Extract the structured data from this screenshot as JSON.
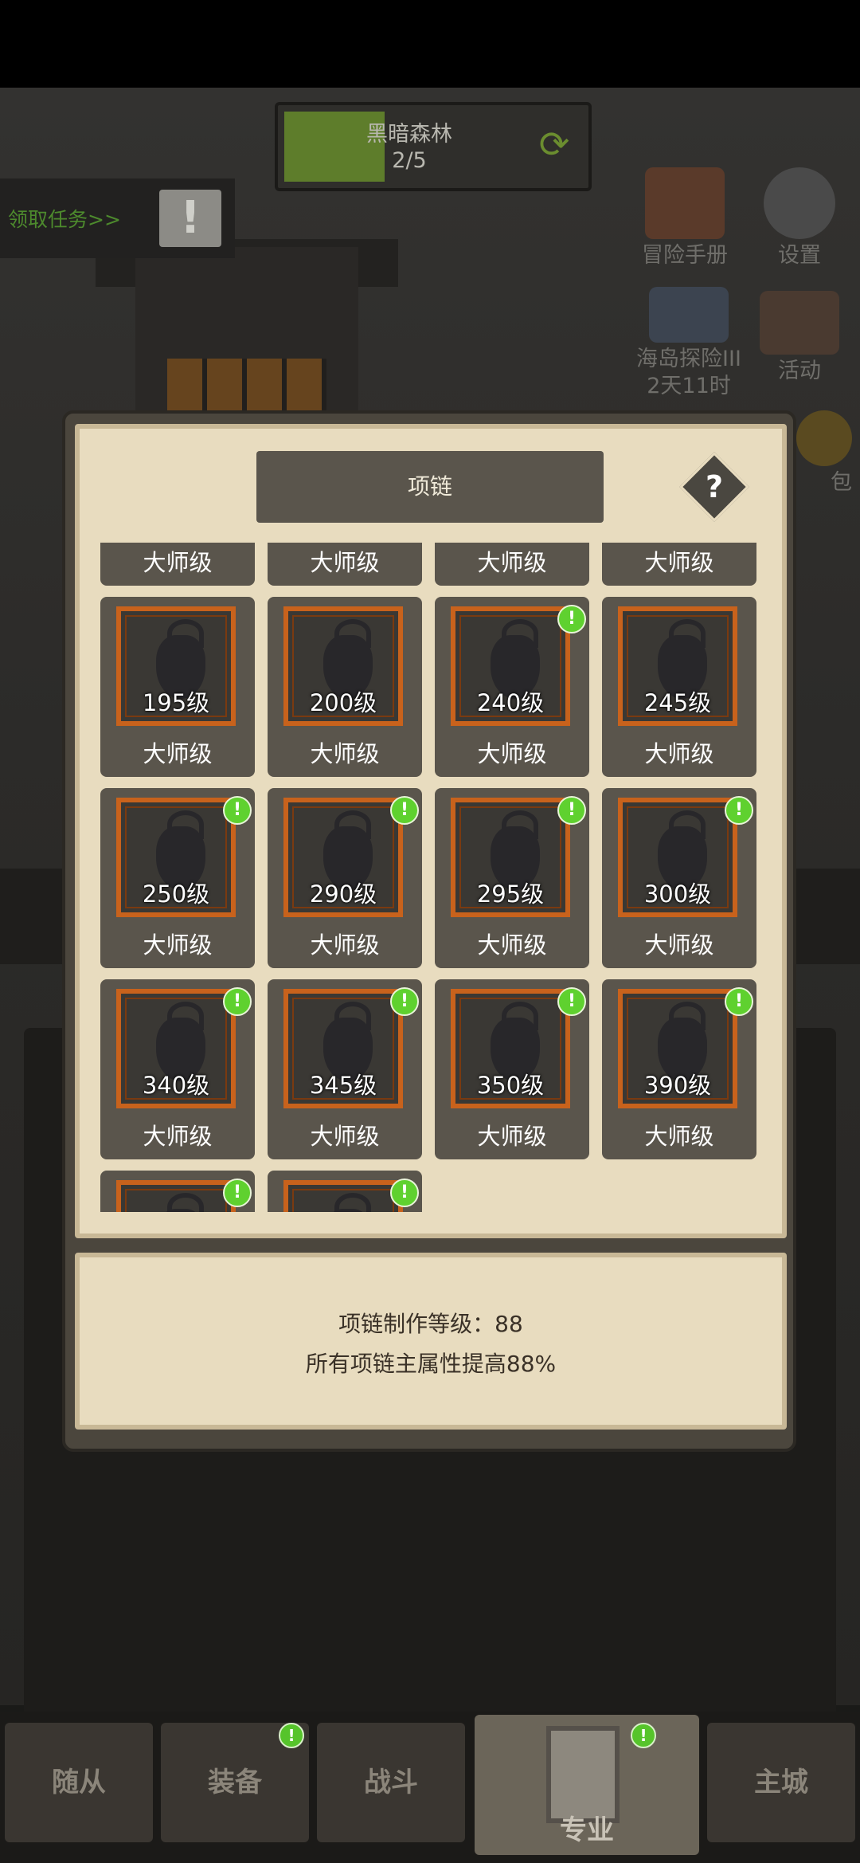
{
  "hud": {
    "area_name": "黑暗森林",
    "area_progress": "2/5",
    "area_progress_fraction": 0.4,
    "quest_button": "领取任务>>",
    "side_icons": [
      {
        "label": "冒险手册",
        "icon": "book-icon"
      },
      {
        "label": "设置",
        "icon": "gear-icon"
      },
      {
        "label": "海岛探险III",
        "sub": "2天11时",
        "icon": "anchor-icon"
      },
      {
        "label": "活动",
        "icon": "scroll-icon"
      },
      {
        "label": "包",
        "icon": "bag-icon"
      }
    ]
  },
  "dialog": {
    "title": "项链",
    "help": "?",
    "top_row_tiers": [
      "大师级",
      "大师级",
      "大师级",
      "大师级"
    ],
    "items": [
      {
        "level": "195级",
        "tier": "大师级",
        "badge": false
      },
      {
        "level": "200级",
        "tier": "大师级",
        "badge": false
      },
      {
        "level": "240级",
        "tier": "大师级",
        "badge": true
      },
      {
        "level": "245级",
        "tier": "大师级",
        "badge": false
      },
      {
        "level": "250级",
        "tier": "大师级",
        "badge": true
      },
      {
        "level": "290级",
        "tier": "大师级",
        "badge": true
      },
      {
        "level": "295级",
        "tier": "大师级",
        "badge": true
      },
      {
        "level": "300级",
        "tier": "大师级",
        "badge": true
      },
      {
        "level": "340级",
        "tier": "大师级",
        "badge": true
      },
      {
        "level": "345级",
        "tier": "大师级",
        "badge": true
      },
      {
        "level": "350级",
        "tier": "大师级",
        "badge": true
      },
      {
        "level": "390级",
        "tier": "大师级",
        "badge": true
      },
      {
        "level": "",
        "tier": "",
        "badge": true
      },
      {
        "level": "",
        "tier": "",
        "badge": true
      }
    ],
    "info_line1": "项链制作等级：88",
    "info_line2": "所有项链主属性提高88%"
  },
  "nav": {
    "tabs": [
      "随从",
      "装备",
      "战斗",
      "专业",
      "主城"
    ],
    "active": "专业"
  },
  "colors": {
    "badge": "#5fd12f",
    "frame": "#c8621c",
    "parchment": "#e8dcbf",
    "progress_fill": "#5e7d2b"
  }
}
